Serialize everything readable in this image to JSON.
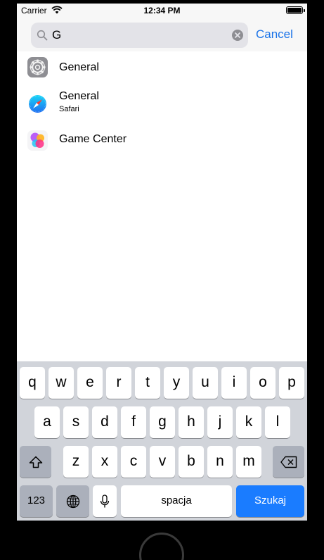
{
  "status_bar": {
    "carrier": "Carrier",
    "time": "12:34 PM"
  },
  "search": {
    "value": "G",
    "cancel_label": "Cancel"
  },
  "results": [
    {
      "title": "General",
      "subtitle": "",
      "icon": "gear-icon"
    },
    {
      "title": "General",
      "subtitle": "Safari",
      "icon": "compass-icon"
    },
    {
      "title": "Game Center",
      "subtitle": "",
      "icon": "game-center-icon"
    }
  ],
  "keyboard": {
    "row1": [
      "q",
      "w",
      "e",
      "r",
      "t",
      "y",
      "u",
      "i",
      "o",
      "p"
    ],
    "row2": [
      "a",
      "s",
      "d",
      "f",
      "g",
      "h",
      "j",
      "k",
      "l"
    ],
    "row3": [
      "z",
      "x",
      "c",
      "v",
      "b",
      "n",
      "m"
    ],
    "numbers_label": "123",
    "space_label": "spacja",
    "return_label": "Szukaj"
  },
  "colors": {
    "accent": "#1a73e8",
    "return_key": "#1a7cff",
    "keyboard_bg": "#d1d4da"
  }
}
